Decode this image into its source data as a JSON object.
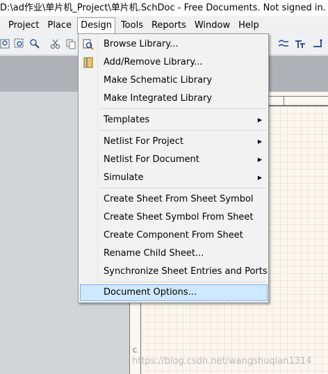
{
  "window": {
    "title": "D:\\ad作业\\单片机_Project\\单片机.SchDoc - Free Documents. Not signed in."
  },
  "menubar": {
    "project": "Project",
    "place": "Place",
    "design": "Design",
    "tools": "Tools",
    "reports": "Reports",
    "window": "Window",
    "help": "Help"
  },
  "design_menu": {
    "browse_library": "Browse Library...",
    "add_remove_library": "Add/Remove Library...",
    "make_schematic_library": "Make Schematic Library",
    "make_integrated_library": "Make Integrated Library",
    "templates": "Templates",
    "netlist_for_project": "Netlist For Project",
    "netlist_for_document": "Netlist For Document",
    "simulate": "Simulate",
    "create_sheet_from_symbol": "Create Sheet From Sheet Symbol",
    "create_symbol_from_sheet": "Create Sheet Symbol From Sheet",
    "create_component_from_sheet": "Create Component From Sheet",
    "rename_child_sheet": "Rename Child Sheet...",
    "sync_sheet_entries": "Synchronize Sheet Entries and Ports",
    "document_options": "Document Options...",
    "submenu_arrow": "▶"
  },
  "sheet": {
    "corner_label": "C"
  },
  "watermark": "https://blog.csdn.net/wangshuqian1314",
  "colors": {
    "highlight": "#cde8ff",
    "highlight_border": "#7eb4ea",
    "sheet_bg": "#fbf7ef"
  }
}
